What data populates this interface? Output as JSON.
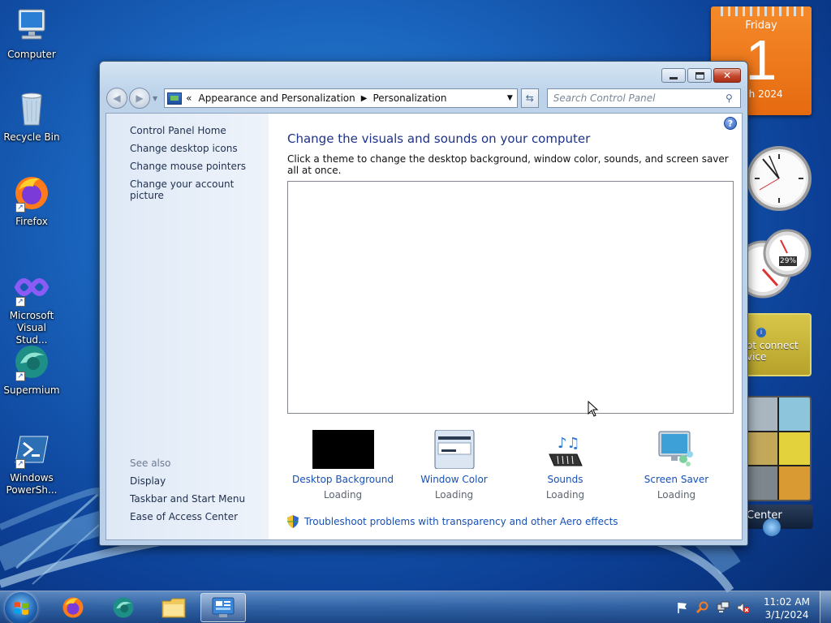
{
  "desktop": {
    "icons": [
      {
        "label": "Computer",
        "icon": "computer-icon"
      },
      {
        "label": "Recycle Bin",
        "icon": "recycle-bin-icon"
      },
      {
        "label": "Firefox",
        "icon": "firefox-icon"
      },
      {
        "label": "Microsoft Visual Stud...",
        "icon": "visual-studio-icon"
      },
      {
        "label": "Supermium",
        "icon": "supermium-icon"
      },
      {
        "label": "Windows PowerSh...",
        "icon": "powershell-icon"
      }
    ]
  },
  "gadgets": {
    "calendar": {
      "day": "Friday",
      "date": "1",
      "month_year": "rch 2024"
    },
    "cpu_meter": {
      "value": "29%"
    },
    "weather": {
      "line1": "ot connect",
      "line2": "vice"
    },
    "media_center": {
      "label": "Center"
    }
  },
  "window": {
    "breadcrumb": {
      "prefix": "«",
      "parent": "Appearance and Personalization",
      "current": "Personalization"
    },
    "search_placeholder": "Search Control Panel",
    "left_pane": {
      "home": "Control Panel Home",
      "links": [
        "Change desktop icons",
        "Change mouse pointers",
        "Change your account picture"
      ],
      "see_also_header": "See also",
      "see_also": [
        "Display",
        "Taskbar and Start Menu",
        "Ease of Access Center"
      ]
    },
    "main": {
      "title": "Change the visuals and sounds on your computer",
      "description": "Click a theme to change the desktop background, window color, sounds, and screen saver all at once.",
      "items": [
        {
          "label": "Desktop Background",
          "status": "Loading",
          "icon": "desktop-background-icon"
        },
        {
          "label": "Window Color",
          "status": "Loading",
          "icon": "window-color-icon"
        },
        {
          "label": "Sounds",
          "status": "Loading",
          "icon": "sounds-icon"
        },
        {
          "label": "Screen Saver",
          "status": "Loading",
          "icon": "screen-saver-icon"
        }
      ],
      "troubleshoot": "Troubleshoot problems with transparency and other Aero effects"
    }
  },
  "taskbar": {
    "apps": [
      "firefox-icon",
      "supermium-icon",
      "file-explorer-icon",
      "control-panel-icon"
    ],
    "time": "11:02 AM",
    "date": "3/1/2024"
  }
}
